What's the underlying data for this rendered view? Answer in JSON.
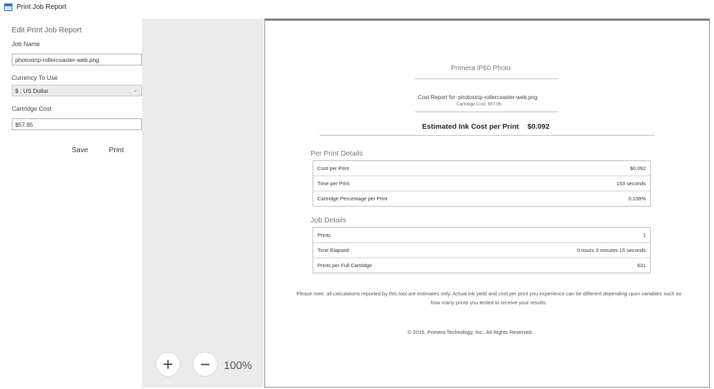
{
  "window": {
    "title": "Print Job Report",
    "icon": "app-window-icon"
  },
  "edit_panel": {
    "title": "Edit Print Job Report",
    "job_name_label": "Job Name",
    "job_name_value": "photostrip-rollercoaster-web.png",
    "currency_label": "Currency To Use",
    "currency_value": "$ : US Dollar",
    "cartridge_cost_label": "Cartridge Cost",
    "cartridge_cost_value": "$57.95",
    "save_label": "Save",
    "print_label": "Print"
  },
  "zoom": {
    "in_symbol": "+",
    "out_symbol": "−",
    "level": "100%"
  },
  "report": {
    "printer_name": "Primera iP60 Photo",
    "cost_report_for": "Cost Report for: photostrip-rollercoaster-web.png",
    "cartridge_cost_line": "Cartridge Cost: $57.95",
    "estimated_label": "Estimated Ink Cost per Print",
    "estimated_value": "$0.092",
    "per_print_title": "Per Print Details",
    "per_print_rows": [
      {
        "label": "Cost per Print",
        "value": "$0.092"
      },
      {
        "label": "Time per Print",
        "value": "153 seconds"
      },
      {
        "label": "Cartridge Percentage per Print",
        "value": "0.158%"
      }
    ],
    "job_title": "Job Details",
    "job_rows": [
      {
        "label": "Prints",
        "value": "1"
      },
      {
        "label": "Time Elapsed",
        "value": "0 hours 3 minutes 15 seconds"
      },
      {
        "label": "Prints per Full Cartridge",
        "value": "631"
      }
    ],
    "note": "Please note: all calculations reported by this tool are estimates only. Actual ink yield and cost per print you experience can be different depending upon variables such as how many prints you tested to receive your results.",
    "copyright": "© 2015, Primera Technology, Inc., All Rights Reserved."
  }
}
